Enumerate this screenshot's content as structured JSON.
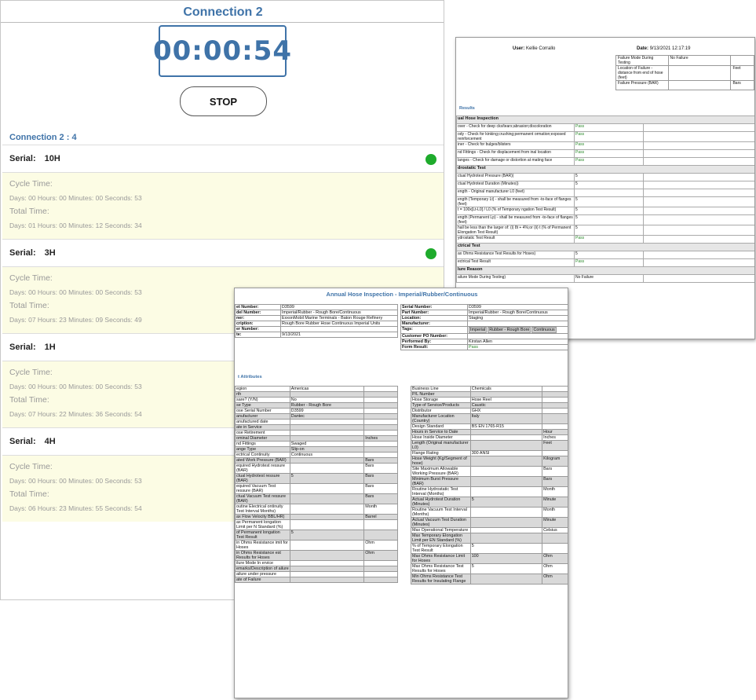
{
  "app": {
    "title": "Connection 2",
    "timer": "00:00:54",
    "stop_label": "STOP",
    "connection_header": "Connection 2 : 4",
    "status_color": "#1eab2c",
    "serials": [
      {
        "label": "Serial:",
        "value": "10H",
        "active": true,
        "cycle_label": "Cycle Time:",
        "cycle": "Days: 00  Hours: 00  Minutes: 00  Seconds: 53",
        "total_label": "Total Time:",
        "total": "Days: 01  Hours: 00  Minutes: 12  Seconds: 34"
      },
      {
        "label": "Serial:",
        "value": "3H",
        "active": true,
        "cycle_label": "Cycle Time:",
        "cycle": "Days: 00  Hours: 00  Minutes: 00  Seconds: 53",
        "total_label": "Total Time:",
        "total": "Days: 07  Hours: 23  Minutes: 09  Seconds: 49"
      },
      {
        "label": "Serial:",
        "value": "1H",
        "active": false,
        "cycle_label": "Cycle Time:",
        "cycle": "Days: 00  Hours: 00  Minutes: 00  Seconds: 53",
        "total_label": "Total Time:",
        "total": "Days: 07  Hours: 22  Minutes: 36  Seconds: 54"
      },
      {
        "label": "Serial:",
        "value": "4H",
        "active": false,
        "cycle_label": "Cycle Time:",
        "cycle": "Days: 00  Hours: 00  Minutes: 00  Seconds: 53",
        "total_label": "Total Time:",
        "total": "Days: 06  Hours: 23  Minutes: 55  Seconds: 54"
      }
    ]
  },
  "doc1": {
    "user_label": "User:",
    "user": "Kellie Corrallo",
    "date_label": "Date:",
    "date": "9/13/2021  12:17:19",
    "failure_table": [
      [
        "Failure Mode During Testing",
        "No Failure",
        ""
      ],
      [
        "Location of Failure - distance from end of hose (feet)",
        "",
        "Feet"
      ],
      [
        "Failure Pressure (BAR)",
        "",
        "Bars"
      ]
    ],
    "results_label": "Results",
    "rows": [
      {
        "sec": true,
        "label": "ual Hose Inspection",
        "val": ""
      },
      {
        "label": "over - Check for deep cks/tears;abrasion;discoloration",
        "val": "Pass"
      },
      {
        "label": "ody - Check for kinking;crushing;permanent ormation;exposed reinforcement",
        "val": "Pass"
      },
      {
        "label": "iner - Check for bulges/blisters",
        "val": "Pass"
      },
      {
        "label": "nd Fittings - Check for displacement from inal location",
        "val": "Pass"
      },
      {
        "label": "langes - Check for damage or distortion at mating face",
        "val": "Pass"
      },
      {
        "sec": true,
        "label": "drostatic Test",
        "val": ""
      },
      {
        "label": "ctual Hydrotest Pressure (BAR))",
        "val": "5"
      },
      {
        "label": "ctual Hydrotest Duration (Minutes))",
        "val": "5"
      },
      {
        "label": "ength - Original manufacturer L0 (feet)",
        "val": ""
      },
      {
        "label": "ength (Temporary Lt) - shall be measured from -to-face of flanges (feet)",
        "val": "5"
      },
      {
        "label": "t = 100x[Lt-L0] / L0     (% of Temporary ngation Test Result)",
        "val": "5"
      },
      {
        "label": "ength (Permanent Lp) - shall be measured from -to-face of flanges (feet)",
        "val": "5"
      },
      {
        "label": "hall be less than the larger of: (i) 8t + 4%;or (ii) t     (% of Permanent Elongation Test Result)",
        "val": "5"
      },
      {
        "label": "ydrostatic Test Result",
        "val": "Pass"
      },
      {
        "sec": true,
        "label": "ctrical Test",
        "val": ""
      },
      {
        "label": "ax Ohms Resistance Test Results for Hoses)",
        "val": "5"
      },
      {
        "label": "ectrical Test Result",
        "val": "Pass"
      },
      {
        "sec": true,
        "label": "lure Reason",
        "val": ""
      },
      {
        "label": "ailure Mode During Testing)",
        "val": "No Failure"
      }
    ]
  },
  "doc2": {
    "title": "Annual Hose Inspection - Imperial/Rubber/Continuous",
    "header_left": [
      [
        "et Number:",
        "D3599"
      ],
      [
        "del Number:",
        "Imperial/Rubber - Rough Bore/Continuous"
      ],
      [
        "ner:",
        "ExxonMobil Marine Terminals - Baton Rouge Refinery"
      ],
      [
        "cription:",
        "Rough Bore Rubber Hose Continuous Imperial Units"
      ],
      [
        "er Number:",
        ""
      ],
      [
        "te:",
        "9/13/2021"
      ]
    ],
    "header_right": [
      [
        "Serial Number:",
        "D3599"
      ],
      [
        "Part Number:",
        "Imperial/Rubber - Rough Bore/Continuous"
      ],
      [
        "Location:",
        "Staging"
      ],
      [
        "Manufacturer:",
        ""
      ],
      [
        "Tags:",
        ""
      ],
      [
        "Customer PO Number:",
        ""
      ],
      [
        "Performed By:",
        "Kirstan Allen"
      ],
      [
        "Form Result:",
        "Pass"
      ]
    ],
    "tags": [
      "Imperial",
      "Rubber - Rough Bore",
      "Continuous"
    ],
    "attributes_label": "t Attributes",
    "attr_left": [
      [
        "egion",
        "Americas",
        ""
      ],
      [
        "rth",
        "",
        ""
      ],
      [
        "sare? (Y/N)",
        "No",
        ""
      ],
      [
        "se Type",
        "Rubber - Rough Bore",
        ""
      ],
      [
        "ose Serial Number",
        "D3599",
        ""
      ],
      [
        "anufacturer",
        "Dantec",
        ""
      ],
      [
        "anufactured date",
        "",
        ""
      ],
      [
        "ate in Service",
        "",
        ""
      ],
      [
        "ose Retirement",
        "",
        ""
      ],
      [
        "ominal Diameter",
        "",
        "Inches"
      ],
      [
        "nd Fittings",
        "Swaged",
        ""
      ],
      [
        "ange Type",
        "Slip-on",
        ""
      ],
      [
        "ectrical Continuity",
        "Continuous",
        ""
      ],
      [
        "ated Work Pressure (BAR)",
        "",
        "Bars"
      ],
      [
        "equired Hydrotest ressure (BAR)",
        "",
        "Bars"
      ],
      [
        "ctual Hydrotest ressure (BAR)",
        "5",
        "Bars"
      ],
      [
        "equired Vacuum Test ressure (BAR)",
        "",
        "Bars"
      ],
      [
        "ctual Vacuum Test ressure (BAR)",
        "",
        "Bars"
      ],
      [
        "outine Electrical ontinuity Test Interval Months)",
        "",
        "Month"
      ],
      [
        "ax Flow Velocity BBL/HR)",
        "",
        "Barrel"
      ],
      [
        "ax Permanent longation Limit per N Standard (%)",
        "",
        ""
      ],
      [
        "of Permanent longation Test Result",
        "5",
        ""
      ],
      [
        "in Ohms Resistance imit for Hoses",
        "",
        "Ohm"
      ],
      [
        "in Ohms Resistance est Results for Hoses",
        "",
        "Ohm"
      ],
      [
        "ilure Mode In ervice",
        "",
        ""
      ],
      [
        "emarks/Description of ailure",
        "",
        ""
      ],
      [
        "ailure under pressure",
        "",
        ""
      ],
      [
        "ate of Failure",
        "",
        ""
      ]
    ],
    "attr_right": [
      [
        "Business Line",
        "Chemicals",
        ""
      ],
      [
        "P/L Number",
        "",
        ""
      ],
      [
        "Hose Storage",
        "Hose Reel",
        ""
      ],
      [
        "Type of Service/Products",
        "Caustic",
        ""
      ],
      [
        "Distributor",
        "GHX",
        ""
      ],
      [
        "Manufacturer Location (Country)",
        "Italy",
        ""
      ],
      [
        "Design Standard",
        "BS EN 1765-R15",
        ""
      ],
      [
        "Hours in Service to Date",
        "",
        "Hour"
      ],
      [
        "Hose Inside Diameter",
        "",
        "Inches"
      ],
      [
        "Length (Original manufacturer L0)",
        "",
        "Feet"
      ],
      [
        "Flange Rating",
        "300 ANSI",
        ""
      ],
      [
        "Hose Weight (Kg/Segment of hose)",
        "",
        "Kilogram"
      ],
      [
        "Site Maximum Allowable Working Pressure (BAR)",
        "",
        "Bars"
      ],
      [
        "Minimum Burst Pressure (BAR)",
        "",
        "Bars"
      ],
      [
        "Routine Hydrostatic Test Interval (Months)",
        "",
        "Month"
      ],
      [
        "Actual Hydrotest Duration (Minutes)",
        "5",
        "Minute"
      ],
      [
        "Routine Vacuum Test Interval (Months)",
        "",
        "Month"
      ],
      [
        "Actual Vacuum Test Duration (Minutes)",
        "",
        "Minute"
      ],
      [
        "Max Operational Temperature",
        "",
        "Celsius"
      ],
      [
        "Max Temporary Elongation Limit per EN Standard (%)",
        "",
        ""
      ],
      [
        "% of Temporary Elongation Test Result",
        "5",
        ""
      ],
      [
        "Max Ohms Resistance Limit for Hoses",
        "100",
        "Ohm"
      ],
      [
        "Max Ohms Resistance Test Results for Hoses",
        "5",
        "Ohm"
      ],
      [
        "Min Ohms Resistance Test Results for Insulating Flange",
        "",
        "Ohm"
      ]
    ]
  }
}
